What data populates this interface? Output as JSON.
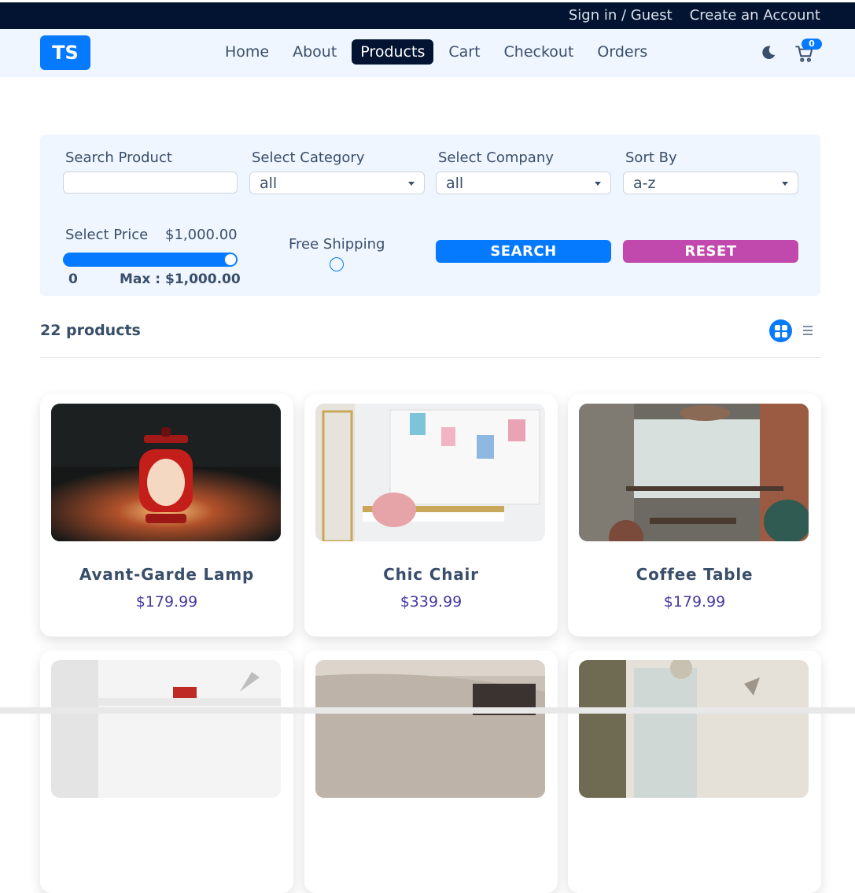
{
  "topbar": {
    "sign_in": "Sign in / Guest",
    "create_account": "Create an Account"
  },
  "navbar": {
    "logo": "TS",
    "links": [
      "Home",
      "About",
      "Products",
      "Cart",
      "Checkout",
      "Orders"
    ],
    "active": "Products",
    "cart_count": "0",
    "icons": [
      "moon-icon",
      "cart-icon"
    ]
  },
  "filters": {
    "search_label": "Search Product",
    "search_value": "",
    "category_label": "Select Category",
    "category_value": "all",
    "company_label": "Select Company",
    "company_value": "all",
    "sort_label": "Sort By",
    "sort_value": "a-z",
    "price_label": "Select Price",
    "price_value": "$1,000.00",
    "price_min": "0",
    "price_max": "Max : $1,000.00",
    "price_fill": 1.0,
    "shipping_label": "Free Shipping",
    "search_button": "SEARCH",
    "reset_button": "RESET"
  },
  "products_header": {
    "count": "22 products"
  },
  "products": [
    {
      "name": "Avant-Garde Lamp",
      "price": "$179.99"
    },
    {
      "name": "Chic Chair",
      "price": "$339.99"
    },
    {
      "name": "Coffee Table",
      "price": "$179.99"
    },
    {
      "name": "",
      "price": ""
    },
    {
      "name": "",
      "price": ""
    },
    {
      "name": "",
      "price": ""
    }
  ],
  "colors": {
    "primary": "#057aff",
    "secondary": "#c149ad",
    "dark": "#021431",
    "price": "#463aa1"
  }
}
